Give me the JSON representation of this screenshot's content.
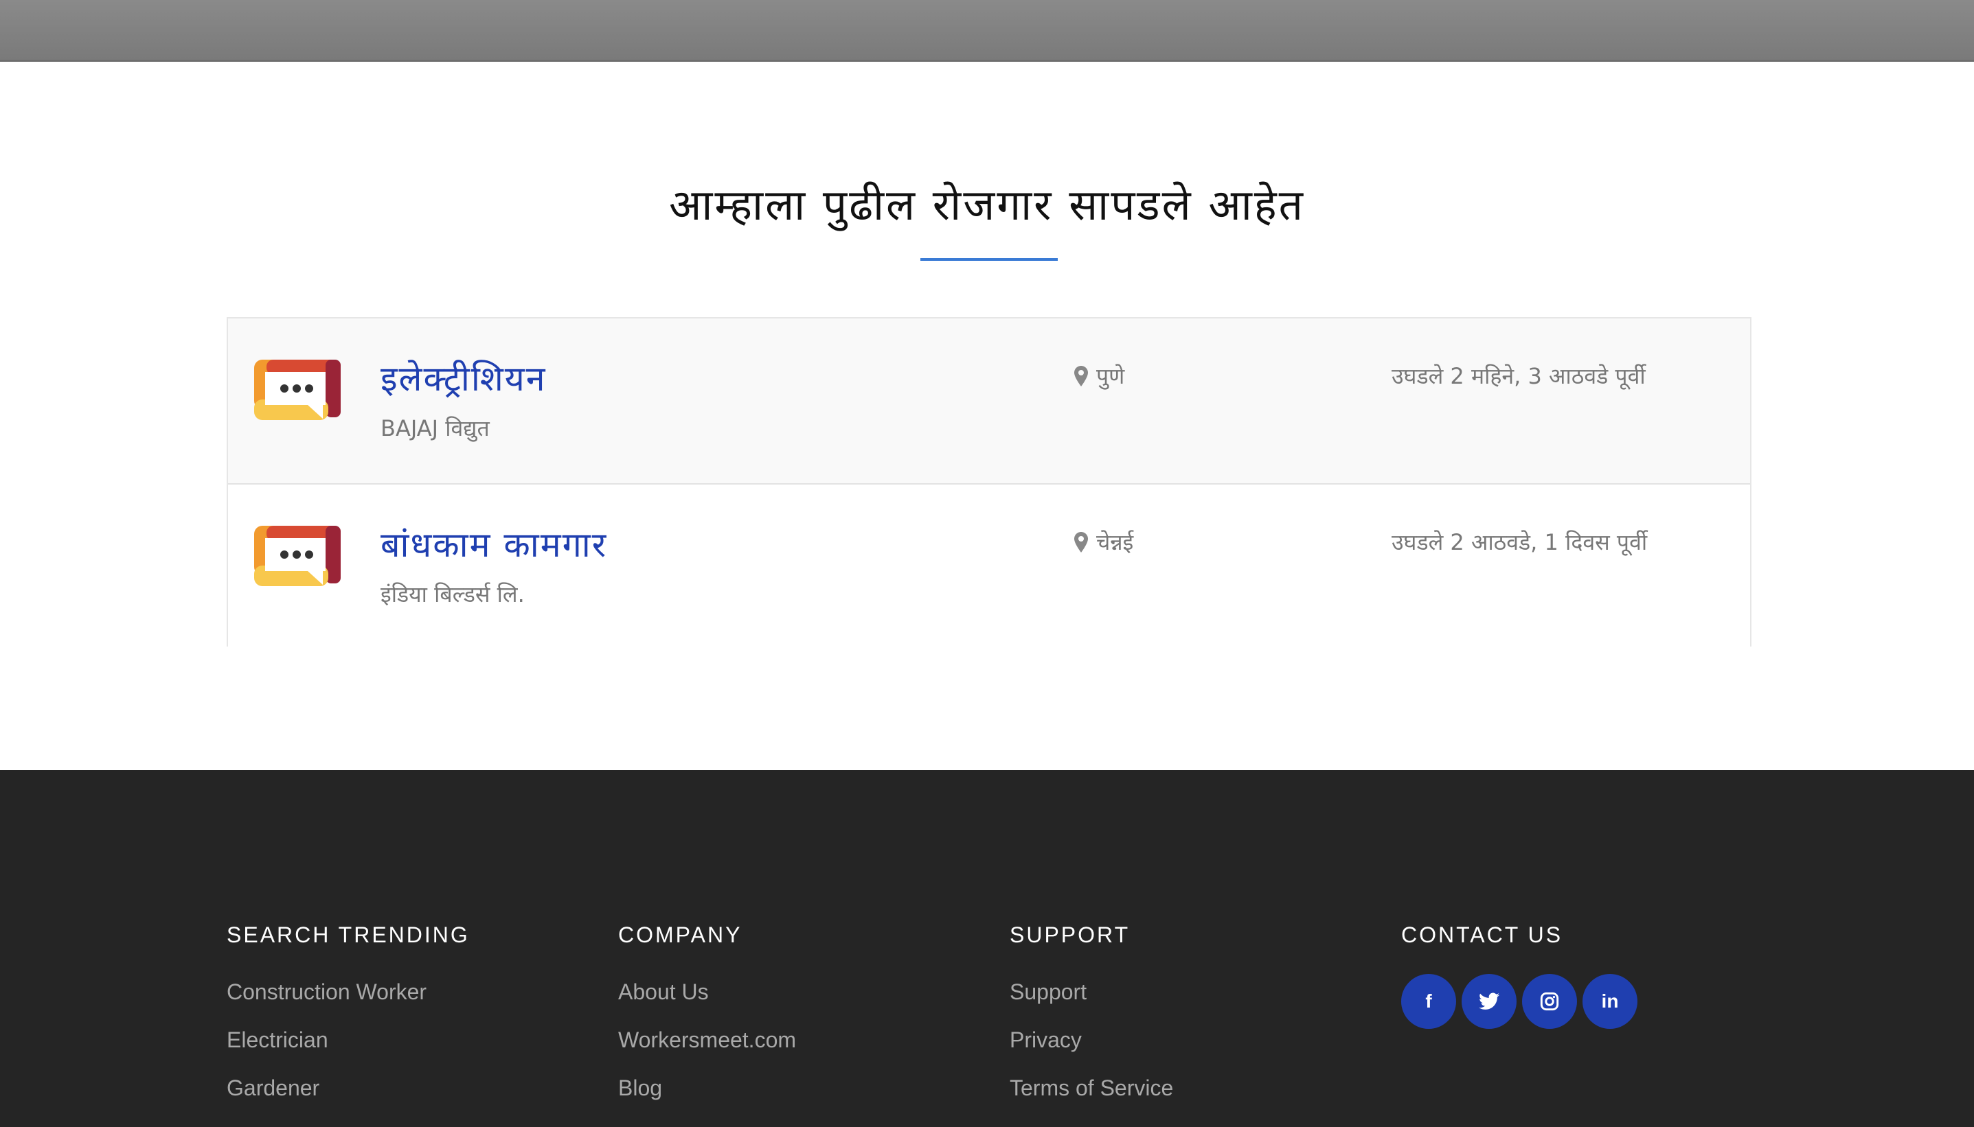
{
  "section": {
    "title": "आम्हाला पुढील रोजगार सापडले आहेत"
  },
  "jobs": [
    {
      "title": "इलेक्ट्रीशियन",
      "company": "BAJAJ विद्युत",
      "location": "पुणे",
      "posted": "उघडले 2 महिने, 3 आठवडे पूर्वी",
      "icon": "chat-bubble-icon"
    },
    {
      "title": "बांधकाम कामगार",
      "company": "इंडिया बिल्डर्स लि.",
      "location": "चेन्नई",
      "posted": "उघडले 2 आठवडे, 1 दिवस पूर्वी",
      "icon": "chat-bubble-icon"
    }
  ],
  "footer": {
    "search_trending": {
      "heading": "SEARCH TRENDING",
      "links": [
        "Construction Worker",
        "Electrician",
        "Gardener"
      ]
    },
    "company": {
      "heading": "COMPANY",
      "links": [
        "About Us",
        "Workersmeet.com",
        "Blog"
      ]
    },
    "support": {
      "heading": "SUPPORT",
      "links": [
        "Support",
        "Privacy",
        "Terms of Service"
      ]
    },
    "contact": {
      "heading": "CONTACT US",
      "social": [
        {
          "icon": "facebook-icon",
          "glyph": "f"
        },
        {
          "icon": "twitter-icon",
          "glyph": ""
        },
        {
          "icon": "instagram-icon",
          "glyph": ""
        },
        {
          "icon": "linkedin-icon",
          "glyph": "in"
        }
      ]
    }
  },
  "colors": {
    "accent": "#1f3fb0",
    "underline": "#3a7bd5",
    "footer_bg": "#252525",
    "topbar": "#7f7f7f"
  }
}
